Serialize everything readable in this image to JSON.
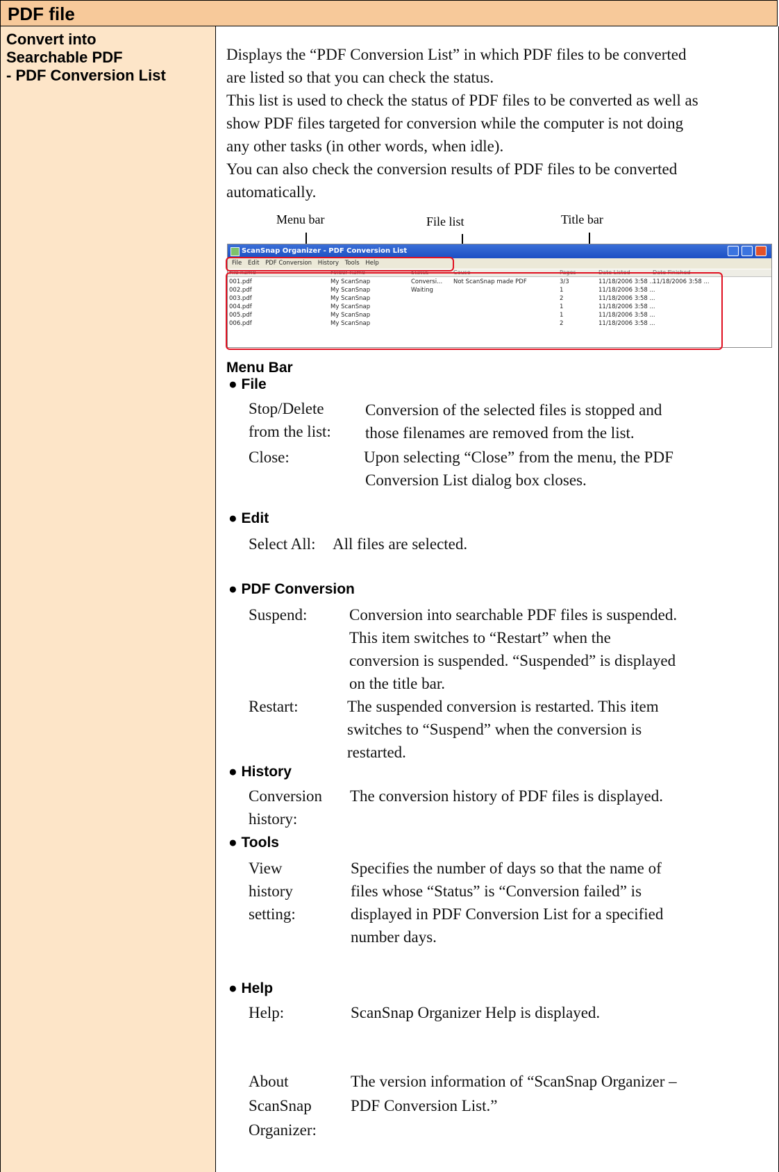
{
  "header": {
    "title": "PDF file"
  },
  "side": {
    "title_lines": [
      "Convert into",
      "Searchable PDF",
      "- PDF Conversion List"
    ]
  },
  "intro": {
    "lines": [
      "Displays the “PDF Conversion List” in which PDF files to be converted",
      "are listed so that you can check the status.",
      "This list is used to check the status of PDF files to be converted as well as",
      "show PDF files targeted for conversion while the computer is not doing",
      "any other tasks (in other words, when idle).",
      "You can also check the conversion results of PDF files to be converted",
      "automatically."
    ]
  },
  "figure": {
    "labels": {
      "menu_bar": "Menu bar",
      "file_list": "File list",
      "title_bar": "Title bar"
    },
    "window_title": "ScanSnap Organizer - PDF Conversion List",
    "menu": [
      "File",
      "Edit",
      "PDF Conversion",
      "History",
      "Tools",
      "Help"
    ],
    "columns": [
      "File name",
      "Folder name",
      "Status",
      "Cause",
      "Pages",
      "Date Listed",
      "Date Finished"
    ],
    "rows": [
      [
        "001.pdf",
        "My ScanSnap",
        "Conversi...",
        "Not ScanSnap made PDF",
        "3/3",
        "11/18/2006 3:58 ...",
        "11/18/2006 3:58 ..."
      ],
      [
        "002.pdf",
        "My ScanSnap",
        "Waiting",
        "",
        "1",
        "11/18/2006 3:58 ...",
        ""
      ],
      [
        "003.pdf",
        "My ScanSnap",
        "",
        "",
        "2",
        "11/18/2006 3:58 ...",
        ""
      ],
      [
        "004.pdf",
        "My ScanSnap",
        "",
        "",
        "1",
        "11/18/2006 3:58 ...",
        ""
      ],
      [
        "005.pdf",
        "My ScanSnap",
        "",
        "",
        "1",
        "11/18/2006 3:58 ...",
        ""
      ],
      [
        "006.pdf",
        "My ScanSnap",
        "",
        "",
        "2",
        "11/18/2006 3:58 ...",
        ""
      ]
    ]
  },
  "menu_bar_heading": "Menu Bar",
  "sections": {
    "file": {
      "title": "● File",
      "stop_label": [
        "Stop/Delete",
        "from the list:"
      ],
      "stop_desc": [
        "Conversion of the selected files is stopped and",
        "those filenames are removed from the list."
      ],
      "close_label": "Close:",
      "close_desc": [
        "Upon selecting “Close” from the menu, the PDF",
        "Conversion List dialog box closes."
      ]
    },
    "edit": {
      "title": "● Edit",
      "select_label": "Select All:",
      "select_desc": "All files are selected."
    },
    "pdf": {
      "title": "● PDF Conversion",
      "suspend_label": "Suspend:",
      "suspend_desc": [
        "Conversion into searchable PDF files is suspended.",
        "This item switches to “Restart” when the",
        "conversion is suspended. “Suspended” is displayed",
        "on the title bar."
      ],
      "restart_label": "Restart:",
      "restart_desc": [
        "The suspended conversion is restarted. This item",
        "switches to “Suspend” when the conversion is",
        "restarted."
      ]
    },
    "history": {
      "title": "● History",
      "label": [
        "Conversion",
        "history:"
      ],
      "desc": "The conversion history of PDF files is displayed."
    },
    "tools": {
      "title": "● Tools",
      "label": [
        "View",
        "history",
        "setting:"
      ],
      "desc": [
        "Specifies the number of days so that the name of",
        "files whose “Status” is “Conversion failed” is",
        "displayed in PDF Conversion List for a specified",
        "number days."
      ]
    },
    "help": {
      "title": "● Help",
      "help_label": "Help:",
      "help_desc": "ScanSnap Organizer Help is displayed.",
      "about_label": [
        "About",
        "ScanSnap",
        "Organizer:"
      ],
      "about_desc": [
        "The version information of “ScanSnap Organizer –",
        "PDF Conversion List.”"
      ]
    }
  }
}
